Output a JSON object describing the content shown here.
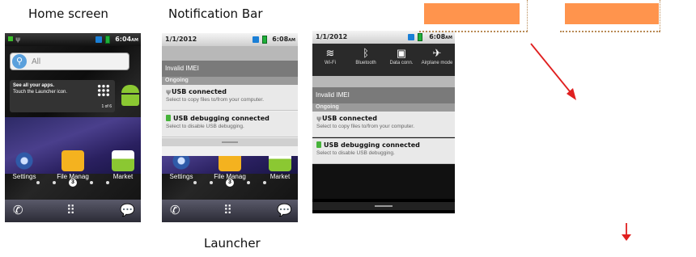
{
  "captions": {
    "home_screen": "Home screen",
    "notification_bar": "Notification Bar",
    "launcher": "Launcher"
  },
  "phone1": {
    "time": "6:04",
    "time_suffix": "AM",
    "search_placeholder": "All",
    "widget_title": "See all your apps.",
    "widget_sub": "Touch the Launcher icon.",
    "widget_page": "1 of 6",
    "apps": [
      "Settings",
      "File Manag",
      "Market"
    ],
    "page_indicator": "3"
  },
  "phone2": {
    "date": "1/1/2012",
    "time": "6:08",
    "time_suffix": "AM",
    "imei": "Invalid IMEI",
    "ongoing": "Ongoing",
    "notif1_title": "USB connected",
    "notif1_sub": "Select to copy files to/from your computer.",
    "notif2_title": "USB debugging connected",
    "notif2_sub": "Select to disable USB debugging.",
    "apps": [
      "Settings",
      "File Manag",
      "Market"
    ],
    "page_indicator": "3"
  },
  "phone3": {
    "date": "1/1/2012",
    "time": "6:08",
    "time_suffix": "AM",
    "toggles": [
      "Wi-Fi",
      "Bluetooth",
      "Data conn.",
      "Airplane mode"
    ],
    "imei": "Invalid IMEI",
    "ongoing": "Ongoing",
    "notif1_title": "USB connected",
    "notif1_sub": "Select to copy files to/from your computer.",
    "notif2_title": "USB debugging connected",
    "notif2_sub": "Select to disable USB debugging."
  },
  "colors": {
    "orange": "#ff944d",
    "arrow_red": "#e02020",
    "dock_purple": "#3f3580"
  }
}
